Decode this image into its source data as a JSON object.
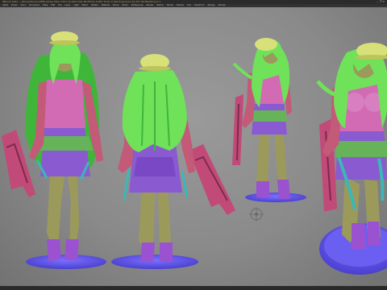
{
  "window": {
    "title": "ZBrush 2021 — [ProjectScene.ZPR]  Active Mem 7341  Scratch Disk 48  ZTime 0.087  Timer 0.042  PolyCount 24.357 KP  MeshCount 1",
    "controls": "— ❐ ✕"
  },
  "menu": {
    "items": [
      "Alpha",
      "Brush",
      "Color",
      "Document",
      "Draw",
      "Edit",
      "File",
      "Layer",
      "Light",
      "Macro",
      "Marker",
      "Material",
      "Movie",
      "Picker",
      "Preferences",
      "Render",
      "Stencil",
      "Stroke",
      "Texture",
      "Tool",
      "Transform",
      "Zplugin",
      "Zscript"
    ]
  },
  "status": {
    "text": "· · · · ·"
  },
  "icons": {
    "gizmo": "transform-gizmo-icon"
  },
  "colors": {
    "skin": "#9c9a5b",
    "hair": "#6fe25a",
    "hair_dark": "#3fb63a",
    "hat": "#d8e07a",
    "top": "#d26ab4",
    "skirt": "#8a5ad0",
    "frill": "#66b35a",
    "jacket": "#c25a78",
    "boots": "#9a52d0",
    "strap": "#3ab8b8",
    "gun": "#c24a78",
    "base": "#5a4ee0"
  }
}
